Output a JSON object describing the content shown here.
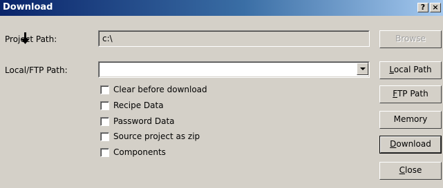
{
  "window": {
    "title": "Download",
    "help_button": "?",
    "close_button": "×"
  },
  "form": {
    "project_path_label": "Project Path:",
    "project_path_value": "c:\\",
    "local_ftp_path_label": "Local/FTP Path:",
    "local_ftp_path_value": ""
  },
  "checkboxes": [
    {
      "label": "Clear before download",
      "checked": false
    },
    {
      "label": "Recipe Data",
      "checked": false
    },
    {
      "label": "Password Data",
      "checked": false
    },
    {
      "label": "Source project as zip",
      "checked": false
    },
    {
      "label": "Components",
      "checked": false
    }
  ],
  "buttons": {
    "browse": {
      "label": "Browse",
      "enabled": false
    },
    "local_path": {
      "mnemonic": "L",
      "rest": "ocal Path"
    },
    "ftp_path": {
      "mnemonic": "F",
      "rest": "TP Path"
    },
    "memory": {
      "label": "Memory"
    },
    "download": {
      "mnemonic": "D",
      "rest": "ownload"
    },
    "close": {
      "mnemonic": "C",
      "rest": "lose"
    }
  },
  "icons": {
    "path_flow_arrow": "arrow-down-icon"
  }
}
